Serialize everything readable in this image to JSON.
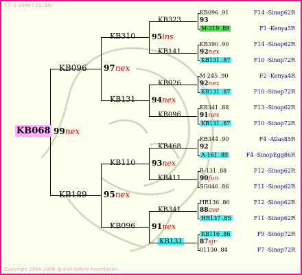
{
  "header_text": "17-  1-2006 ( 21: 16)",
  "footer_text": "Copyright 2004-2006 @ Karl Kehrle Foundation.",
  "colors": {
    "frame": "#e2168a",
    "background": "#fffff0",
    "suffix": "#e00000",
    "right_label": "#000080",
    "highlight_magenta": "#ffb2ff",
    "highlight_cyan": "#55eeee",
    "highlight_green": "#55e055"
  },
  "gen0": {
    "name": "KB068",
    "num": "99",
    "suffix": "nex",
    "highlight": "magenta"
  },
  "gen1": [
    {
      "name": "KB096",
      "num": "97",
      "suffix": "nex"
    },
    {
      "name": "KB189",
      "num": "95",
      "suffix": "nex"
    }
  ],
  "gen2": [
    {
      "name": "KB310",
      "num": "95",
      "suffix": "ins"
    },
    {
      "name": "KB131",
      "num": "94",
      "suffix": "nex"
    },
    {
      "name": "KB110",
      "num": "93",
      "suffix": "nex"
    },
    {
      "name": "KB096",
      "num": "91",
      "suffix": "nex"
    }
  ],
  "gen3": [
    {
      "name": "KB323",
      "num": "93",
      "suffix": ""
    },
    {
      "name": "KB141",
      "num": "92",
      "suffix": "nex"
    },
    {
      "name": "KB026",
      "num": "92",
      "suffix": "nex"
    },
    {
      "name": "KB096",
      "num": "91",
      "suffix": "nex"
    },
    {
      "name": "KB468",
      "num": "92",
      "suffix": ""
    },
    {
      "name": "KB411",
      "num": "90",
      "suffix": "fun"
    },
    {
      "name": "KB341",
      "num": "88",
      "suffix": "ave"
    },
    {
      "name": "KB131",
      "num": "87",
      "suffix": "sjr",
      "highlight": "cyan"
    }
  ],
  "gen4": [
    {
      "label": "KB096 .91",
      "right": "F14 -Sinop62R"
    },
    {
      "label": "M-319 .89",
      "right": "F1 -Kenya5R",
      "highlight": "green"
    },
    {
      "label": "KB390 .90",
      "right": "F14 -Sinop62R"
    },
    {
      "label": "KB131 .87",
      "right": "F10 -Sinop72R",
      "highlight": "cyan"
    },
    {
      "label": "M-245 .90",
      "right": "F2 -Kenya4R"
    },
    {
      "label": "KB131 .87",
      "right": "F10 -Sinop72R",
      "highlight": "cyan"
    },
    {
      "label": "KB341 .88",
      "right": "F13 -Sinop62R"
    },
    {
      "label": "KB131 .87",
      "right": "F10 -Sinop72R",
      "highlight": "cyan"
    },
    {
      "label": "KB344 .90",
      "right": "F4 -Atlas85R"
    },
    {
      "label": "A-161 .89",
      "right": "F4 -SinopEgg86R",
      "highlight": "cyan"
    },
    {
      "label": "B-131 .88",
      "right": "F12 -Sinop62R"
    },
    {
      "label": "SG046 .86",
      "right": "F11 -Sinop62R"
    },
    {
      "label": "HR136 .86",
      "right": "F12 -Sinop62R"
    },
    {
      "label": "HR137 .85",
      "right": "F11 -Sinop62R",
      "highlight": "cyan"
    },
    {
      "label": "KB116 .86",
      "right": "F9 -Sinop72R",
      "highlight": "cyan"
    },
    {
      "label": "01130 .84",
      "right": "F7 -Sinop72R"
    }
  ]
}
